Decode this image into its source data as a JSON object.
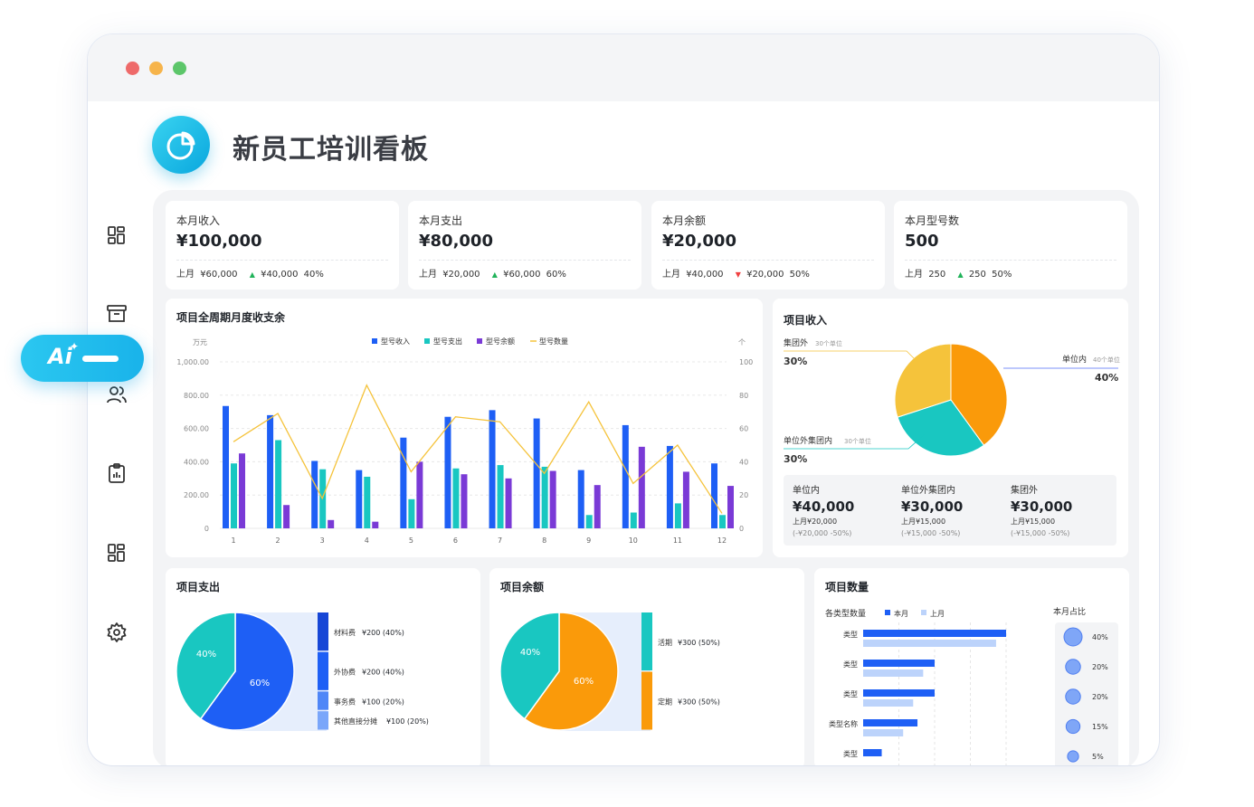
{
  "page": {
    "title": "新员工培训看板"
  },
  "window": {
    "dots": [
      "#ee6a6a",
      "#f6b44b",
      "#5cc66a"
    ]
  },
  "ai_button": {
    "label": "Ai"
  },
  "sidebar": {
    "icons": [
      "dashboard-icon",
      "archive-icon",
      "users-icon",
      "clipboard-chart-icon",
      "dashboard-icon",
      "gear-icon"
    ]
  },
  "kpis": [
    {
      "label": "本月收入",
      "value": "¥100,000",
      "prev_label": "上月",
      "prev_value": "¥60,000",
      "delta": "¥40,000",
      "pct": "40%",
      "trend": "up"
    },
    {
      "label": "本月支出",
      "value": "¥80,000",
      "prev_label": "上月",
      "prev_value": "¥20,000",
      "delta": "¥60,000",
      "pct": "60%",
      "trend": "up"
    },
    {
      "label": "本月余额",
      "value": "¥20,000",
      "prev_label": "上月",
      "prev_value": "¥40,000",
      "delta": "¥20,000",
      "pct": "50%",
      "trend": "down"
    },
    {
      "label": "本月型号数",
      "value": "500",
      "prev_label": "上月",
      "prev_value": "250",
      "delta": "250",
      "pct": "50%",
      "trend": "up"
    }
  ],
  "colors": {
    "blue": "#1e5ff5",
    "teal": "#19c7c1",
    "purple": "#7a3ad6",
    "yellow": "#f5c33b",
    "orange": "#fa9a0a",
    "light_blue": "#bcd3fb",
    "up": "#21b35a",
    "down": "#f04040"
  },
  "chart_data": [
    {
      "id": "monthly",
      "type": "bar",
      "title": "项目全周期月度收支余",
      "y_unit_left": "万元",
      "y_unit_right": "个",
      "ylim": [
        0,
        1000
      ],
      "y2lim": [
        0,
        100
      ],
      "yticks": [
        "0",
        "200.00",
        "400.00",
        "600.00",
        "800.00",
        "1,000.00"
      ],
      "y2ticks": [
        "0",
        "20",
        "40",
        "60",
        "80",
        "100"
      ],
      "categories": [
        "1",
        "2",
        "3",
        "4",
        "5",
        "6",
        "7",
        "8",
        "9",
        "10",
        "11",
        "12"
      ],
      "legend": [
        "型号收入",
        "型号支出",
        "型号余额",
        "型号数量"
      ],
      "series": [
        {
          "name": "型号收入",
          "type": "bar",
          "values": [
            735,
            680,
            405,
            350,
            545,
            670,
            710,
            660,
            350,
            620,
            495,
            390
          ]
        },
        {
          "name": "型号支出",
          "type": "bar",
          "values": [
            390,
            530,
            355,
            310,
            175,
            360,
            380,
            370,
            80,
            95,
            150,
            80
          ]
        },
        {
          "name": "型号余额",
          "type": "bar",
          "values": [
            450,
            140,
            50,
            40,
            400,
            325,
            300,
            345,
            260,
            490,
            340,
            255
          ]
        },
        {
          "name": "型号数量",
          "type": "line",
          "axis": "right",
          "values": [
            52,
            69,
            18,
            86,
            34,
            67,
            64,
            33,
            76,
            27,
            50,
            9
          ]
        }
      ]
    },
    {
      "id": "income",
      "type": "pie",
      "title": "项目收入",
      "slices": [
        {
          "name": "单位内",
          "note": "40个单位",
          "pct": "40%",
          "value": 40,
          "color": "#fa9a0a"
        },
        {
          "name": "单位外集团内",
          "note": "30个单位",
          "pct": "30%",
          "value": 30,
          "color": "#19c7c1"
        },
        {
          "name": "集团外",
          "note": "30个单位",
          "pct": "30%",
          "value": 30,
          "color": "#f5c33b"
        }
      ],
      "summary": [
        {
          "label": "单位内",
          "value": "¥40,000",
          "prev": "上月¥20,000",
          "delta": "(-¥20,000 -50%)"
        },
        {
          "label": "单位外集团内",
          "value": "¥30,000",
          "prev": "上月¥15,000",
          "delta": "(-¥15,000 -50%)"
        },
        {
          "label": "集团外",
          "value": "¥30,000",
          "prev": "上月¥15,000",
          "delta": "(-¥15,000 -50%)"
        }
      ]
    },
    {
      "id": "expense",
      "type": "pie",
      "title": "项目支出",
      "slices": [
        {
          "pct": "60%",
          "value": 60,
          "color": "#1e5ff5"
        },
        {
          "pct": "40%",
          "value": 40,
          "color": "#19c7c1"
        }
      ],
      "breakdown": [
        {
          "name": "材料费",
          "value": "¥200 (40%)",
          "share": 40,
          "color": "#1646d6"
        },
        {
          "name": "外协费",
          "value": "¥200 (40%)",
          "share": 40,
          "color": "#1e5ff5"
        },
        {
          "name": "事务费",
          "value": "¥100 (20%)",
          "share": 20,
          "color": "#4f86f7"
        },
        {
          "name": "其他直接分摊",
          "value": "¥100 (20%)",
          "share": 20,
          "color": "#7aa6fa"
        }
      ]
    },
    {
      "id": "balance",
      "type": "pie",
      "title": "项目余额",
      "slices": [
        {
          "pct": "60%",
          "value": 60,
          "color": "#fa9a0a"
        },
        {
          "pct": "40%",
          "value": 40,
          "color": "#19c7c1"
        }
      ],
      "breakdown": [
        {
          "name": "活期",
          "value": "¥300 (50%)",
          "share": 50,
          "color": "#19c7c1"
        },
        {
          "name": "定期",
          "value": "¥300 (50%)",
          "share": 50,
          "color": "#fa9a0a"
        }
      ]
    },
    {
      "id": "count",
      "type": "bar",
      "title": "项目数量",
      "subtitle": "各类型数量",
      "legend": [
        "本月",
        "上月"
      ],
      "categories": [
        "类型",
        "类型",
        "类型",
        "类型名称",
        "类型"
      ],
      "series": [
        {
          "name": "本月",
          "values": [
            100,
            50,
            50,
            38,
            13
          ]
        },
        {
          "name": "上月",
          "values": [
            93,
            42,
            35,
            28,
            0
          ]
        }
      ],
      "share_title": "本月占比",
      "shares": [
        "40%",
        "20%",
        "20%",
        "15%",
        "5%"
      ],
      "share_values": [
        40,
        20,
        20,
        15,
        5
      ]
    }
  ]
}
